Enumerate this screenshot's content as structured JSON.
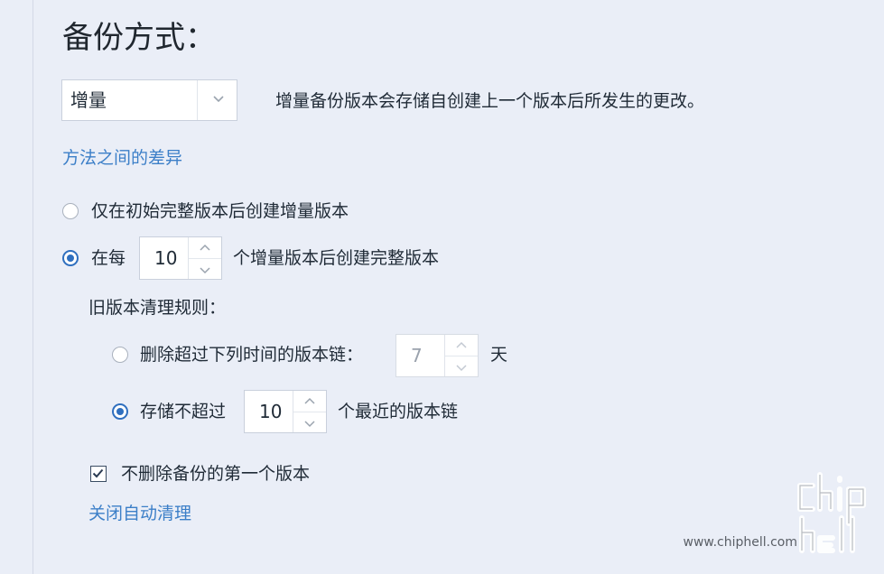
{
  "section": {
    "title": "备份方式："
  },
  "method_select": {
    "value": "增量",
    "description": "增量备份版本会存储自创建上一个版本后所发生的更改。"
  },
  "links": {
    "differences": "方法之间的差异",
    "disable_cleanup": "关闭自动清理"
  },
  "full_version_options": {
    "option_initial": {
      "label": "仅在初始完整版本后创建增量版本",
      "selected": false
    },
    "option_every": {
      "prefix": "在每",
      "value": "10",
      "suffix": "个增量版本后创建完整版本",
      "selected": true
    }
  },
  "cleanup": {
    "heading": "旧版本清理规则：",
    "delete_older": {
      "label": "删除超过下列时间的版本链：",
      "value": "7",
      "unit": "天",
      "selected": false
    },
    "keep_recent": {
      "prefix": "存储不超过",
      "value": "10",
      "suffix": "个最近的版本链",
      "selected": true
    },
    "keep_first": {
      "label": "不删除备份的第一个版本",
      "checked": true
    }
  },
  "watermark": {
    "text": "www.chiphell.com"
  },
  "colors": {
    "accent": "#2f6fbf",
    "link": "#3c7fc8",
    "background": "#eaeef7"
  }
}
